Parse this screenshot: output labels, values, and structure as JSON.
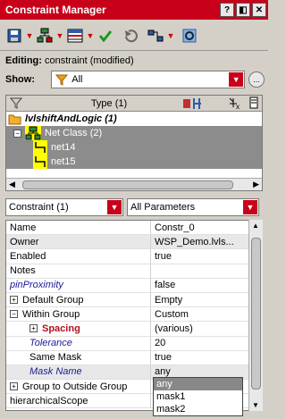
{
  "window": {
    "title": "Constraint Manager",
    "buttons": [
      "?",
      "◧",
      "✕"
    ]
  },
  "toolbar": {
    "icons": [
      "save-icon",
      "net-class-icon",
      "table-icon",
      "check-icon",
      "undo-icon",
      "route-icon",
      "zoom-fit-icon"
    ]
  },
  "editing": {
    "label": "Editing:",
    "value": "constraint (modified)"
  },
  "show": {
    "label": "Show:",
    "value": "All",
    "more": "..."
  },
  "tree": {
    "header_label": "Type (1)",
    "rows": [
      {
        "label": "lvlshiftAndLogic (1)",
        "indent": 0
      },
      {
        "label": "Net Class (2)",
        "indent": 1
      },
      {
        "label": "net14",
        "indent": 2
      },
      {
        "label": "net15",
        "indent": 2
      }
    ]
  },
  "filters": {
    "left": "Constraint (1)",
    "right": "All Parameters"
  },
  "properties": [
    {
      "name": "Name",
      "value": "Constr_0",
      "style": "normal",
      "indent": 0
    },
    {
      "name": "Owner",
      "value": "WSP_Demo.lvls...",
      "style": "normal",
      "indent": 0
    },
    {
      "name": "Enabled",
      "value": "true",
      "style": "normal",
      "indent": 0
    },
    {
      "name": "Notes",
      "value": "",
      "style": "normal",
      "indent": 0
    },
    {
      "name": "pinProximity",
      "value": "false",
      "style": "italic",
      "indent": 0
    },
    {
      "name": "Default Group",
      "value": "Empty",
      "style": "normal",
      "indent": 0,
      "expander": "+"
    },
    {
      "name": "Within Group",
      "value": "Custom",
      "style": "normal",
      "indent": 0,
      "expander": "−"
    },
    {
      "name": "Spacing",
      "value": "(various)",
      "style": "bold-red",
      "indent": 1,
      "expander": "+"
    },
    {
      "name": "Tolerance",
      "value": "20",
      "style": "italic",
      "indent": 2
    },
    {
      "name": "Same Mask",
      "value": "true",
      "style": "normal",
      "indent": 2
    },
    {
      "name": "Mask Name",
      "value": "any",
      "style": "italic",
      "indent": 2
    },
    {
      "name": "Group to Outside Group",
      "value": "",
      "style": "normal",
      "indent": 0,
      "expander": "+"
    },
    {
      "name": "hierarchicalScope",
      "value": "",
      "style": "normal",
      "indent": 0
    }
  ],
  "mask_dropdown": {
    "options": [
      "any",
      "mask1",
      "mask2"
    ],
    "selected": 0
  }
}
